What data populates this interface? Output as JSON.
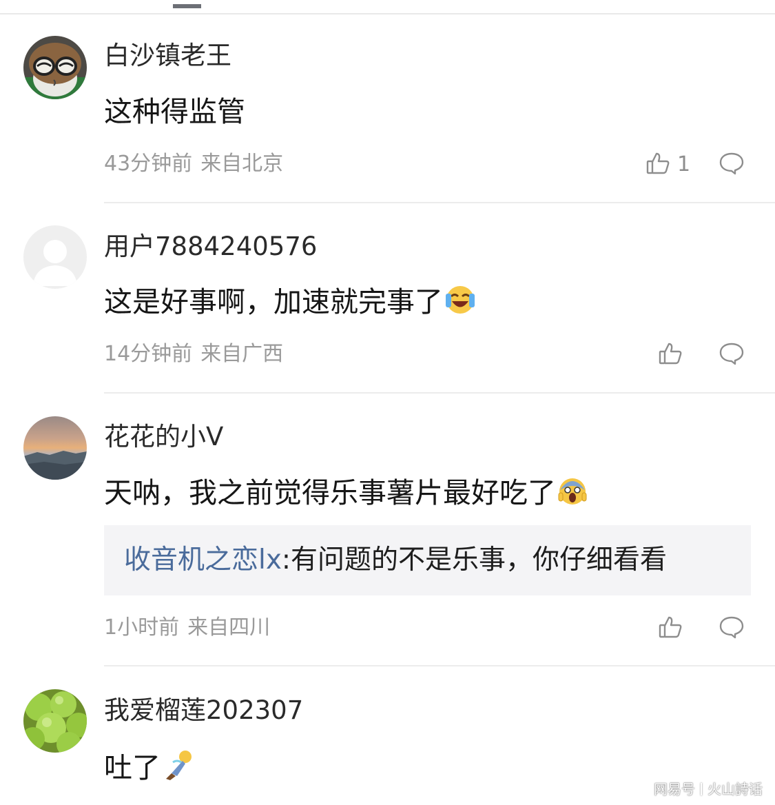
{
  "comments": [
    {
      "username": "白沙镇老王",
      "content": "这种得监管",
      "time": "43分钟前",
      "location": "来自北京",
      "likes": "1"
    },
    {
      "username": "用户7884240576",
      "content": "这是好事啊，加速就完事了",
      "time": "14分钟前",
      "location": "来自广西",
      "emoji": "laughing-tears-emoji"
    },
    {
      "username": "花花的小V",
      "content": "天呐，我之前觉得乐事薯片最好吃了",
      "time": "1小时前",
      "location": "来自四川",
      "emoji": "screaming-face-emoji",
      "reply": {
        "user": "收音机之恋lx",
        "text": ":有问题的不是乐事，你仔细看看"
      }
    },
    {
      "username": "我爱榴莲202307",
      "content": "吐了",
      "emoji": "vomiting-figure-emoji"
    }
  ],
  "watermark": {
    "source": "网易号",
    "author": "火山詩话"
  },
  "colors": {
    "meta_gray": "#9a9a9a",
    "reply_user_blue": "#4a6b9b",
    "reply_bg": "#f4f4f6",
    "divider": "#ececec"
  }
}
